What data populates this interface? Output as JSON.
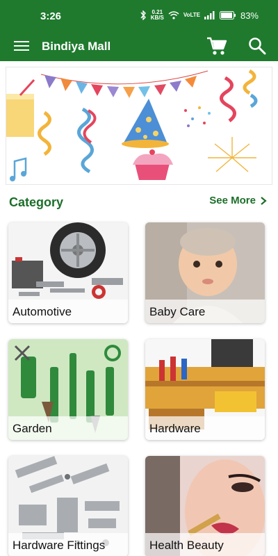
{
  "status_bar": {
    "time": "3:26",
    "net_speed_value": "0.21",
    "net_speed_unit": "KB/S",
    "volte_label": "VoLTE",
    "battery_percent": "83%"
  },
  "app_bar": {
    "title": "Bindiya Mall",
    "icons": [
      "menu-icon",
      "cart-icon",
      "search-icon"
    ]
  },
  "category_section": {
    "title": "Category",
    "see_more_label": "See More",
    "items": [
      {
        "label": "Automotive"
      },
      {
        "label": "Baby Care"
      },
      {
        "label": "Garden"
      },
      {
        "label": "Hardware"
      },
      {
        "label": "Hardware Fittings"
      },
      {
        "label": "Health  Beauty"
      }
    ]
  },
  "colors": {
    "primary": "#1f7a2e",
    "section_text": "#1c6e2a"
  }
}
